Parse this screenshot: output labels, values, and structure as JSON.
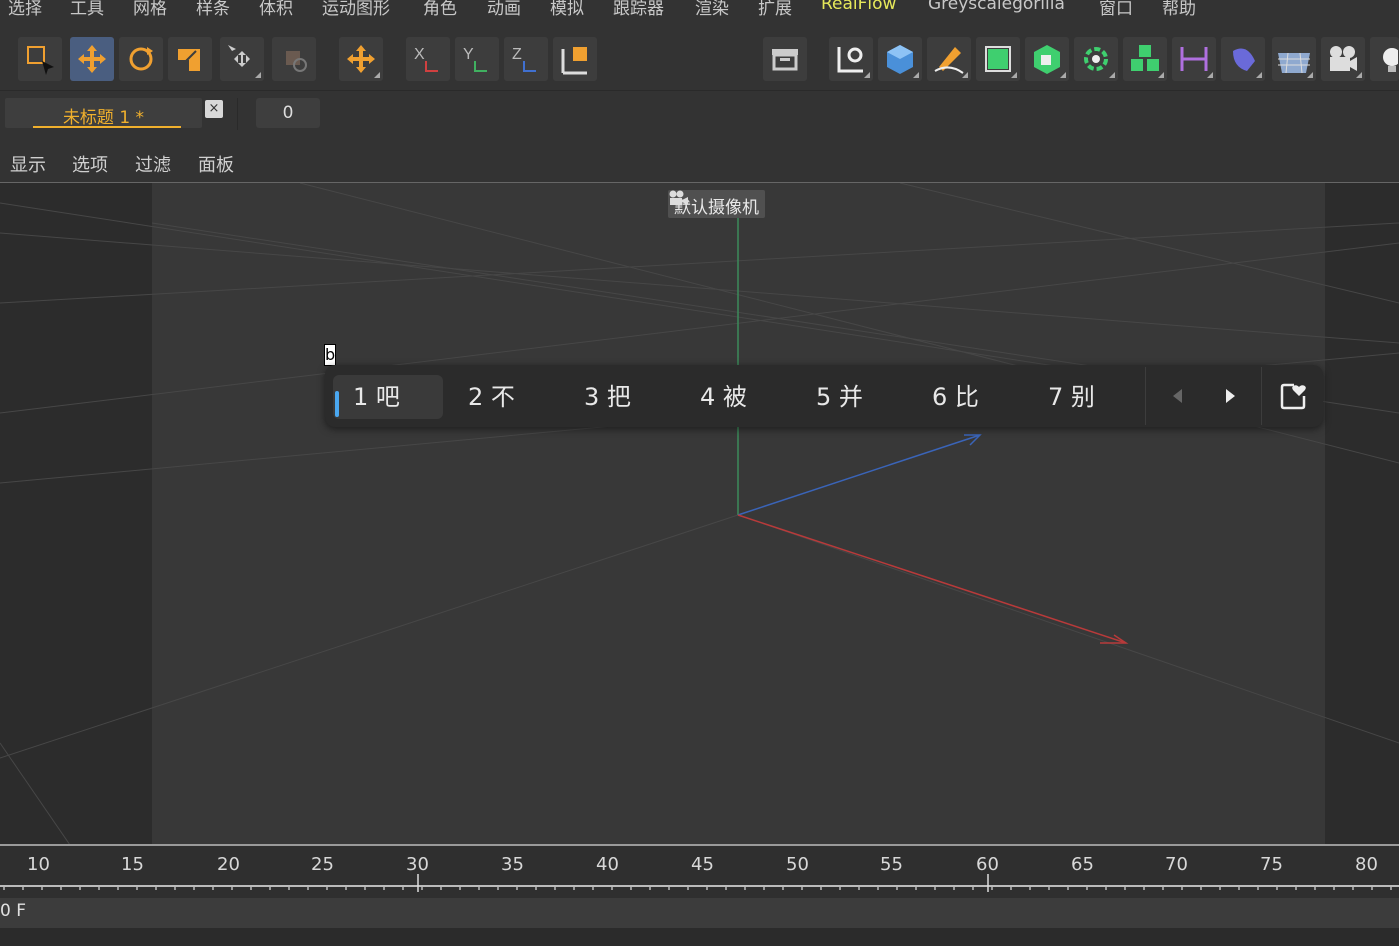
{
  "menu": [
    "选择",
    "工具",
    "网格",
    "样条",
    "体积",
    "运动图形",
    "角色",
    "动画",
    "模拟",
    "跟踪器",
    "渲染",
    "扩展",
    "RealFlow",
    "Greyscalegorilla",
    "窗口",
    "帮助"
  ],
  "menu_colors": {
    "default": "#c8c8c8",
    "realflow": "#e6e85a"
  },
  "toolbar_icons": [
    "live-selection-icon",
    "move-icon",
    "rotate-icon",
    "scale-icon",
    "transform-icon",
    "last-tool-icon",
    "move-axis-icon",
    "x-axis-icon",
    "y-axis-icon",
    "z-axis-icon",
    "coordinate-system-icon",
    "render-view-icon",
    "spline-pen-icon",
    "cube-icon",
    "pen-icon",
    "subdivision-icon",
    "extrude-icon",
    "cloner-icon",
    "array-icon",
    "deformer-icon",
    "field-icon",
    "floor-icon",
    "camera-icon",
    "light-icon"
  ],
  "doc_tab": {
    "title": "未标题 1 *",
    "close": "×"
  },
  "frame_field": "0",
  "viewport_menu": [
    "显示",
    "选项",
    "过滤",
    "面板"
  ],
  "camera_label": "默认摄像机",
  "ime": {
    "input": "b",
    "candidates": [
      {
        "label": "1 吧"
      },
      {
        "label": "2 不"
      },
      {
        "label": "3 把"
      },
      {
        "label": "4 被"
      },
      {
        "label": "5 并"
      },
      {
        "label": "6 比"
      },
      {
        "label": "7 别"
      }
    ]
  },
  "timeline": {
    "ticks": [
      "10",
      "15",
      "20",
      "25",
      "30",
      "35",
      "40",
      "45",
      "50",
      "55",
      "60",
      "65",
      "70",
      "75",
      "80"
    ]
  },
  "frame_status": "0 F",
  "accent_color": "#f0b02d"
}
